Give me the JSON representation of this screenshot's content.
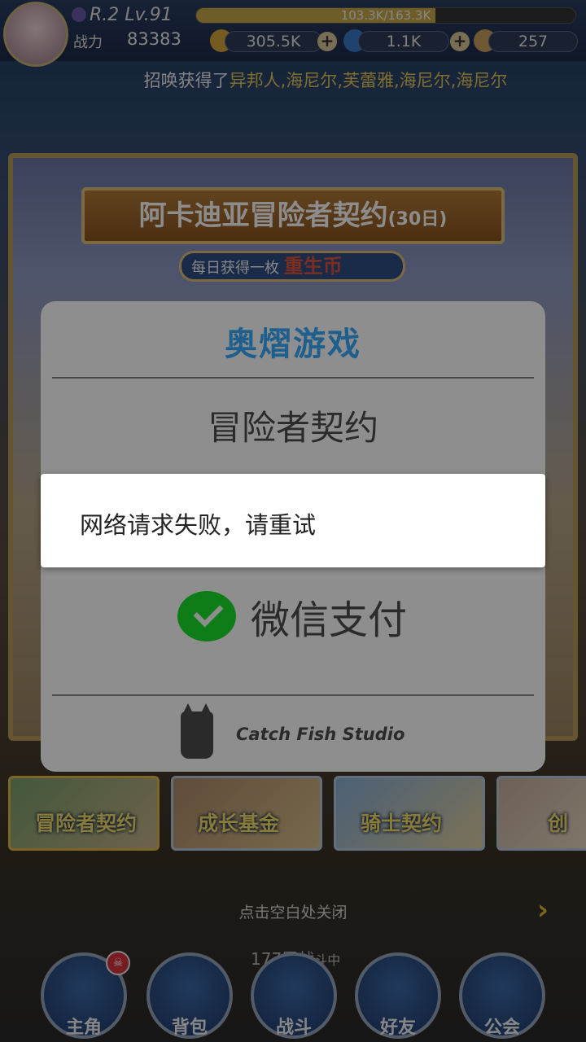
{
  "status": {
    "level_text": "R.2 Lv.91",
    "exp_text": "103.3K/163.3K",
    "exp_progress": 0.63,
    "power_label": "战力",
    "power_value": "83383",
    "gold": "305.5K",
    "diamond": "1.1K",
    "feather": "257"
  },
  "marquee": {
    "prefix": "招唤获得了",
    "names": "异邦人,海尼尔,芙蕾雅,海尼尔,海尼尔"
  },
  "banner": {
    "title": "阿卡迪亚冒险者契约",
    "title_suffix": "(30日)",
    "subtitle_prefix": "每日获得一枚",
    "subtitle_highlight": "重生币"
  },
  "payment_dialog": {
    "brand": "奥熠游戏",
    "product": "冒险者契约",
    "method": "微信支付",
    "studio": "Catch Fish Studio"
  },
  "toast": {
    "message": "网络请求失败，请重试"
  },
  "promos": [
    {
      "label": "冒险者契约"
    },
    {
      "label": "成长基金"
    },
    {
      "label": "骑士契约"
    },
    {
      "label": "创"
    }
  ],
  "close_hint": "点击空白处关闭",
  "floor_text": "177层战",
  "floor_suffix": "斗中",
  "nav": [
    {
      "label": "主角"
    },
    {
      "label": "背包"
    },
    {
      "label": "战斗"
    },
    {
      "label": "好友"
    },
    {
      "label": "公会"
    }
  ],
  "colors": {
    "brand_blue": "#1e5f8d",
    "wechat_green": "#0e7d17",
    "promo_yellow": "#f5e06a"
  }
}
